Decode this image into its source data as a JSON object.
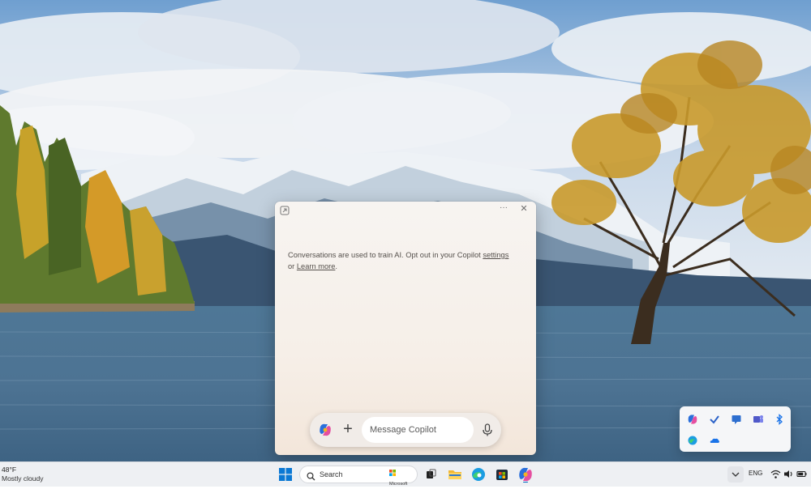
{
  "copilot": {
    "notice_text": "Conversations are used to train AI. Opt out in your Copilot",
    "settings_link": "settings",
    "notice_or": "or",
    "learn_more_link": "Learn more",
    "notice_end": ".",
    "message_placeholder": "Message Copilot",
    "more_label": "···",
    "close_label": "✕",
    "plus_label": "+"
  },
  "taskbar": {
    "weather_temp": "48°F",
    "weather_condition": "Mostly cloudy",
    "search_label": "Search",
    "search_promo": "Microsoft",
    "language": "ENG"
  },
  "tray_flyout_icons": [
    "copilot-icon",
    "checkmark-app-icon",
    "feedback-icon",
    "teams-icon",
    "bluetooth-icon",
    "edge-icon",
    "onedrive-icon"
  ],
  "taskbar_apps": [
    "task-view-icon",
    "file-explorer-icon",
    "edge-browser-icon",
    "microsoft-store-icon",
    "copilot-app-icon"
  ],
  "colors": {
    "accent": "#0067c0",
    "copilot_window": "#f6efe8",
    "taskbar": "#eef0f3"
  }
}
